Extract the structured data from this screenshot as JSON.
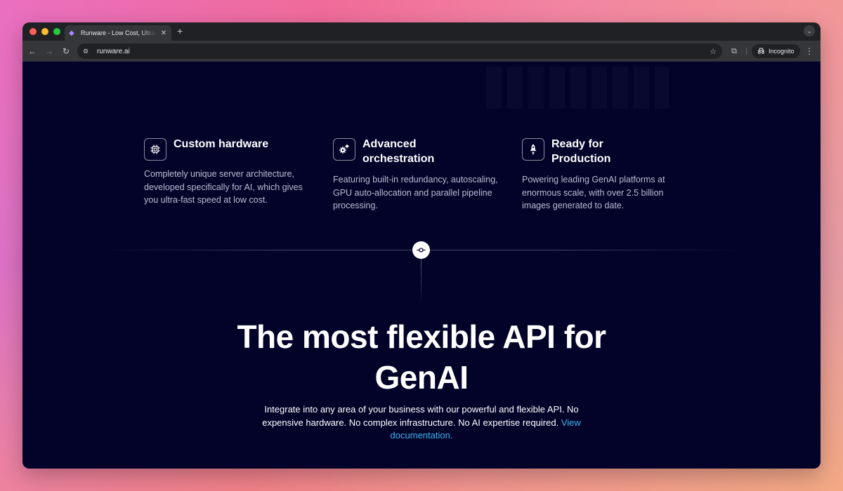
{
  "browser": {
    "tab_title": "Runware - Low Cost, Ultra-Fast",
    "url": "runware.ai",
    "incognito_label": "Incognito"
  },
  "features": [
    {
      "icon": "chip-icon",
      "title": "Custom hardware",
      "description": "Completely unique server architecture, developed specifically for AI, which gives you ultra-fast speed at low cost."
    },
    {
      "icon": "gears-icon",
      "title": "Advanced orchestration",
      "description": "Featuring built-in redundancy, autoscaling, GPU auto-allocation and parallel pipeline processing."
    },
    {
      "icon": "rocket-icon",
      "title": "Ready for Production",
      "description": "Powering leading GenAI platforms at enormous scale, with over 2.5 billion images generated to date."
    }
  ],
  "hero": {
    "headline": "The most flexible API for GenAI",
    "subtitle": "Integrate into any area of your business with our powerful and flexible API. No expensive hardware. No complex infrastructure. No AI expertise required.",
    "link_text": "View documentation."
  },
  "colors": {
    "page_bg": "#03032a",
    "link": "#3fb6f0"
  }
}
